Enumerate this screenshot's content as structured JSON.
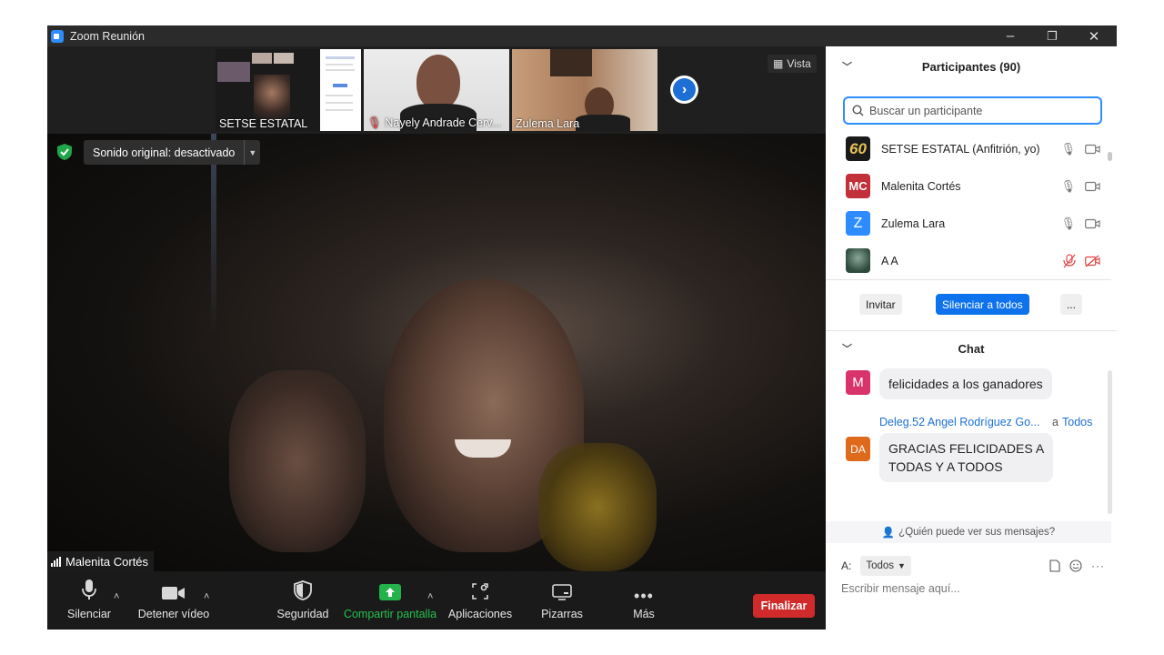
{
  "window": {
    "title": "Zoom Reunión",
    "minimize": "–",
    "maximize": "❐",
    "close": "✕"
  },
  "thumbnails": [
    {
      "name": "SETSE ESTATAL",
      "muted": false
    },
    {
      "name": "Nayely Andrade Cerv...",
      "muted": true
    },
    {
      "name": "Zulema Lara",
      "muted": false
    }
  ],
  "vista_label": "Vista",
  "sound_original": "Sonido original: desactivado",
  "active_speaker": "Malenita Cortés",
  "toolbar": {
    "mute": "Silenciar",
    "stop_video": "Detener vídeo",
    "security": "Seguridad",
    "share": "Compartir pantalla",
    "apps": "Aplicaciones",
    "whiteboards": "Pizarras",
    "more": "Más",
    "end": "Finalizar"
  },
  "participants": {
    "title": "Participantes (90)",
    "search_placeholder": "Buscar un participante",
    "list": [
      {
        "name": "SETSE ESTATAL (Anfitrión, yo)",
        "avatar": "60",
        "color": "#1a1a1a",
        "muted": false
      },
      {
        "name": "Malenita Cortés",
        "avatar": "MC",
        "color": "#c2303a",
        "muted": false
      },
      {
        "name": "Zulema Lara",
        "avatar": "Z",
        "color": "#2d8cff",
        "muted": false
      },
      {
        "name": "A A",
        "avatar": "",
        "color": "#3a5a4a",
        "muted": true
      }
    ],
    "invite": "Invitar",
    "mute_all": "Silenciar a todos",
    "more": "..."
  },
  "chat": {
    "title": "Chat",
    "messages": [
      {
        "avatar": "M",
        "color": "#d9336b",
        "text": "felicidades a los ganadores"
      },
      {
        "avatar": "DA",
        "color": "#e06a1b",
        "sender": "Deleg.52 Angel Rodríguez Go...",
        "to_prefix": "a",
        "to": "Todos",
        "line1": "GRACIAS FELICIDADES A",
        "line2": "TODAS Y A TODOS"
      }
    ],
    "who_can_see": "¿Quién puede ver sus mensajes?",
    "to_label": "A:",
    "to_value": "Todos",
    "input_placeholder": "Escribir mensaje aquí..."
  }
}
